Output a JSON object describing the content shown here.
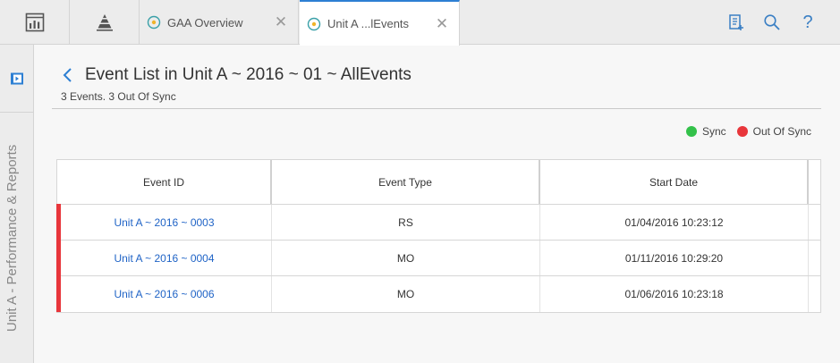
{
  "colors": {
    "accent": "#2d7fd3",
    "sync": "#33c14a",
    "out_of_sync": "#e8363b",
    "link": "#1f63c6"
  },
  "topbar": {
    "app_buttons": [
      {
        "icon": "dashboard-icon"
      },
      {
        "icon": "pyramid-icon"
      }
    ],
    "tabs": [
      {
        "label": "GAA Overview",
        "icon": "radar-icon",
        "active": false
      },
      {
        "label": "Unit A ...lEvents",
        "icon": "radar-icon",
        "active": true
      }
    ],
    "tools": [
      {
        "icon": "report-add-icon"
      },
      {
        "icon": "search-icon"
      },
      {
        "icon": "help-icon",
        "glyph": "?"
      }
    ]
  },
  "sidebar": {
    "label": "Unit A - Performance & Reports"
  },
  "header": {
    "title": "Event List in Unit A ~ 2016 ~ 01 ~ AllEvents",
    "subtitle": "3 Events. 3 Out Of Sync"
  },
  "legend": [
    {
      "label": "Sync",
      "status": "sync"
    },
    {
      "label": "Out Of Sync",
      "status": "out_of_sync"
    }
  ],
  "table": {
    "columns": [
      "Event ID",
      "Event Type",
      "Start Date"
    ],
    "rows": [
      {
        "status": "out_of_sync",
        "event_id": "Unit A ~ 2016 ~ 0003",
        "event_type": "RS",
        "start_date": "01/04/2016 10:23:12"
      },
      {
        "status": "out_of_sync",
        "event_id": "Unit A ~ 2016 ~ 0004",
        "event_type": "MO",
        "start_date": "01/11/2016 10:29:20"
      },
      {
        "status": "out_of_sync",
        "event_id": "Unit A ~ 2016 ~ 0006",
        "event_type": "MO",
        "start_date": "01/06/2016 10:23:18"
      }
    ]
  }
}
